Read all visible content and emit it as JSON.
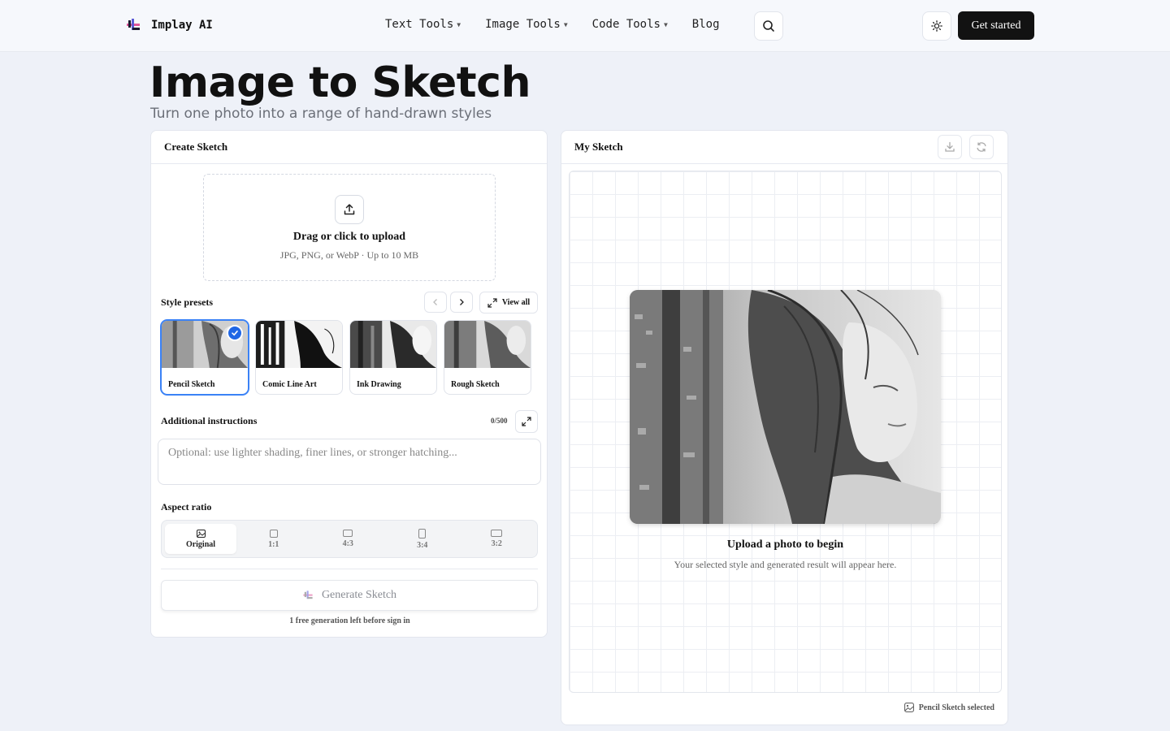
{
  "nav": {
    "brand": "Implay AI",
    "links": [
      "Text Tools",
      "Image Tools",
      "Code Tools",
      "Blog"
    ],
    "cta": "Get started"
  },
  "hero": {
    "title": "Image to Sketch",
    "subtitle": "Turn one photo into a range of hand-drawn styles"
  },
  "create": {
    "header": "Create Sketch",
    "upload_title": "Drag or click to upload",
    "upload_hint": "JPG, PNG, or WebP · Up to 10 MB",
    "style_presets_label": "Style presets",
    "view_all": "View all",
    "presets": [
      {
        "label": "Pencil Sketch",
        "selected": true
      },
      {
        "label": "Comic Line Art",
        "selected": false
      },
      {
        "label": "Ink Drawing",
        "selected": false
      },
      {
        "label": "Rough Sketch",
        "selected": false
      }
    ],
    "instructions_label": "Additional instructions",
    "char_count": "0/500",
    "instructions_placeholder": "Optional: use lighter shading, finer lines, or stronger hatching...",
    "aspect_label": "Aspect ratio",
    "ratios": [
      "Original",
      "1:1",
      "4:3",
      "3:4",
      "3:2"
    ],
    "active_ratio": "Original",
    "generate_label": "Generate Sketch",
    "generate_note": "1 free generation left before sign in"
  },
  "result": {
    "header": "My Sketch",
    "title": "Upload a photo to begin",
    "hint": "Your selected style and generated result will appear here.",
    "footer": "Pencil Sketch selected"
  },
  "colors": {
    "accent": "#1f66e5",
    "cta_bg": "#121212",
    "page_bg": "#eef1f8"
  }
}
